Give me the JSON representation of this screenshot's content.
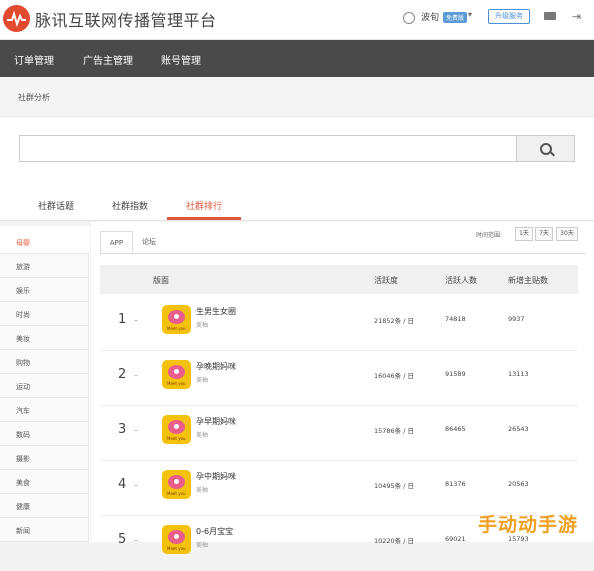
{
  "header": {
    "app_title": "脉讯互联网传播管理平台",
    "user_name": "波旬",
    "user_badge": "免费版",
    "upgrade_label": "升级服务"
  },
  "nav": {
    "items": [
      "订单管理",
      "广告主管理",
      "账号管理"
    ]
  },
  "panel": {
    "title": "社群分析"
  },
  "search": {
    "placeholder": "",
    "value": ""
  },
  "tabs": {
    "items": [
      "社群话题",
      "社群指数",
      "社群排行"
    ],
    "active": "社群排行"
  },
  "sidebar": {
    "items": [
      "母婴",
      "旅游",
      "娱乐",
      "时尚",
      "美妆",
      "购物",
      "运动",
      "汽车",
      "数码",
      "摄影",
      "美食",
      "健康",
      "新闻"
    ],
    "active": "母婴"
  },
  "subtabs": {
    "items": [
      "APP",
      "论坛"
    ],
    "active": "APP"
  },
  "time_range": {
    "label": "时间范围:",
    "options": [
      "1天",
      "7天",
      "30天"
    ]
  },
  "table": {
    "headers": {
      "board": "版面",
      "activity": "活跃度",
      "active_users": "活跃人数",
      "new_posts": "新增主贴数"
    },
    "rows": [
      {
        "rank": "1",
        "name": "生男生女圈",
        "sub": "美柚",
        "activity": "21852条 / 日",
        "active_users": "74818",
        "new_posts": "9937"
      },
      {
        "rank": "2",
        "name": "孕晚期妈咪",
        "sub": "美柚",
        "activity": "16046条 / 日",
        "active_users": "91589",
        "new_posts": "13113"
      },
      {
        "rank": "3",
        "name": "孕早期妈咪",
        "sub": "美柚",
        "activity": "15786条 / 日",
        "active_users": "86465",
        "new_posts": "26543"
      },
      {
        "rank": "4",
        "name": "孕中期妈咪",
        "sub": "美柚",
        "activity": "10495条 / 日",
        "active_users": "81376",
        "new_posts": "20563"
      },
      {
        "rank": "5",
        "name": "0-6月宝宝",
        "sub": "美柚",
        "activity": "10220条 / 日",
        "active_users": "69021",
        "new_posts": "15793"
      }
    ],
    "thumb_caption": "Meet you"
  },
  "watermark": "手动动手游",
  "colors": {
    "accent": "#e0583a",
    "nav_bg": "#4a4a4a",
    "link": "#4a90d9"
  }
}
